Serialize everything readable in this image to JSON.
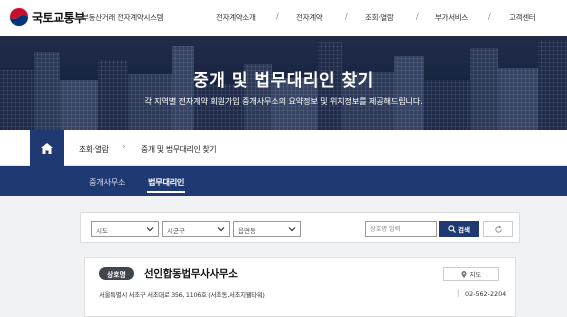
{
  "header": {
    "org_name": "국토교통부",
    "system_name": "부동산거래 전자계약시스템",
    "nav": [
      "전자계약소개",
      "전자계약",
      "조회·열람",
      "부가서비스",
      "고객센터"
    ]
  },
  "banner": {
    "title": "중개 및 법무대리인 찾기",
    "subtitle": "각 지역별 전자계약 회원가입 중개사무소의 요약정보 및 위치정보를 제공해드립니다."
  },
  "breadcrumb": {
    "items": [
      "조회·열람",
      "중개 및 법무대리인 찾기"
    ]
  },
  "tabs": [
    {
      "label": "중개사무소",
      "active": false
    },
    {
      "label": "법무대리인",
      "active": true
    }
  ],
  "filter": {
    "sido": "시도",
    "sigungu": "시군구",
    "eupmyeondong": "읍면동",
    "search_placeholder": "상호명 입력",
    "search_label": "검색"
  },
  "result": {
    "badge": "상호명",
    "name": "선인합동법무사사무소",
    "address": "서울특별시 서초구 서초대로 356, 1106호 (서초동,서초지웰타워)",
    "phone": "02-562-2204",
    "action_label": "지도"
  },
  "colors": {
    "primary": "#1f3a73",
    "badge": "#41454e"
  }
}
